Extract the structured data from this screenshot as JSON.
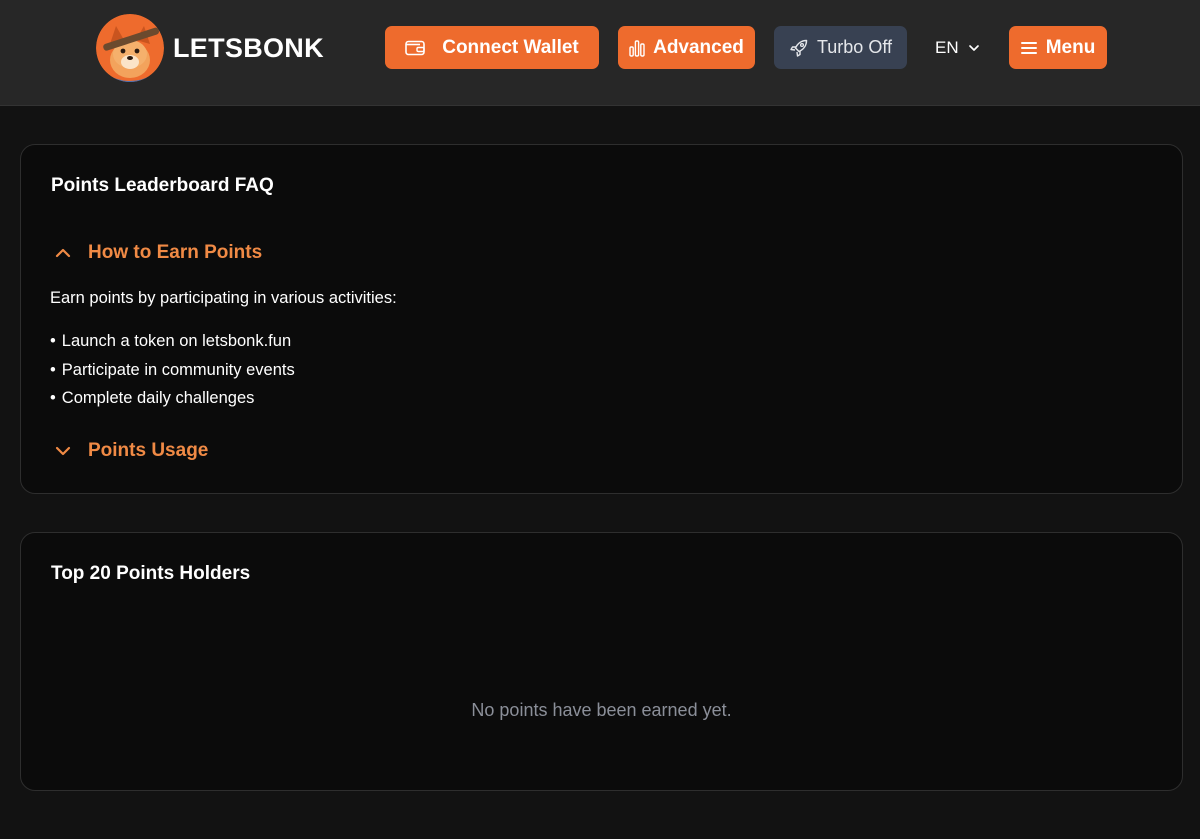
{
  "header": {
    "brand": "LETSBONK",
    "connect_wallet": "Connect Wallet",
    "advanced": "Advanced",
    "turbo": "Turbo Off",
    "language": "EN",
    "menu": "Menu"
  },
  "faq": {
    "title": "Points Leaderboard FAQ",
    "sections": [
      {
        "heading": "How to Earn Points",
        "expanded": true,
        "intro": "Earn points by participating in various activities:",
        "items": [
          "Launch a token on letsbonk.fun",
          "Participate in community events",
          "Complete daily challenges"
        ]
      },
      {
        "heading": "Points Usage",
        "expanded": false
      }
    ]
  },
  "leaderboard": {
    "title": "Top 20 Points Holders",
    "empty_message": "No points have been earned yet."
  },
  "icons": {
    "logo": "bonk-dog-avatar",
    "connect_wallet": "wallet-icon",
    "advanced": "bar-chart-icon",
    "turbo": "rocket-icon",
    "language": "chevron-down-icon",
    "menu": "hamburger-icon",
    "faq_expanded": "chevron-up-icon",
    "faq_collapsed": "chevron-down-icon"
  },
  "colors": {
    "accent": "#ee6b2d",
    "faq_heading": "#f08a45",
    "turbo_bg": "#384152",
    "header_bg": "#272727",
    "page_bg": "#121212",
    "card_bg": "#0b0b0b",
    "muted_text": "#8b8f99"
  }
}
